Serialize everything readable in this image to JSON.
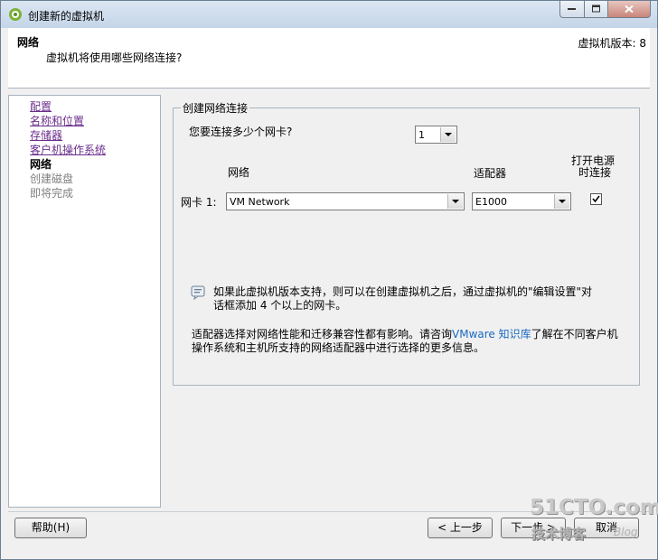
{
  "window": {
    "title": "创建新的虚拟机",
    "controls": {
      "minimize": "minimize-icon",
      "maximize": "maximize-icon",
      "close": "close-icon"
    }
  },
  "header": {
    "title": "网络",
    "subtitle": "虚拟机将使用哪些网络连接?",
    "version": "虚拟机版本: 8"
  },
  "steps": [
    {
      "label": "配置",
      "state": "link"
    },
    {
      "label": "名称和位置",
      "state": "link"
    },
    {
      "label": "存储器",
      "state": "link"
    },
    {
      "label": "客户机操作系统",
      "state": "link"
    },
    {
      "label": "网络",
      "state": "current"
    },
    {
      "label": "创建磁盘",
      "state": "disabled"
    },
    {
      "label": "即将完成",
      "state": "disabled"
    }
  ],
  "main": {
    "group_title": "创建网络连接",
    "nic_count_label": "您要连接多少个网卡?",
    "nic_count_value": "1",
    "col_network": "网络",
    "col_adapter": "适配器",
    "col_power_line1": "打开电源",
    "col_power_line2": "时连接",
    "nic_row_label": "网卡 1:",
    "network_value": "VM Network",
    "adapter_value": "E1000",
    "power_on_checked": true,
    "info_text": "如果此虚拟机版本支持，则可以在创建虚拟机之后，通过虚拟机的\"编辑设置\"对话框添加 4 个以上的网卡。",
    "note_before": "适配器选择对网络性能和迁移兼容性都有影响。请咨询",
    "note_link": "VMware 知识库",
    "note_after": "了解在不同客户机操作系统和主机所支持的网络适配器中进行选择的更多信息。"
  },
  "buttons": {
    "help": "帮助(H)",
    "back": "< 上一步",
    "next": "下一步 >",
    "cancel": "取消"
  },
  "watermark": {
    "logo": "51CTO.com",
    "tagline": "技术博客",
    "blog": "Blog"
  },
  "colors": {
    "link_visited": "#6a2e8c",
    "link": "#1c6ac1",
    "titlebar": "#c4d5e8"
  }
}
